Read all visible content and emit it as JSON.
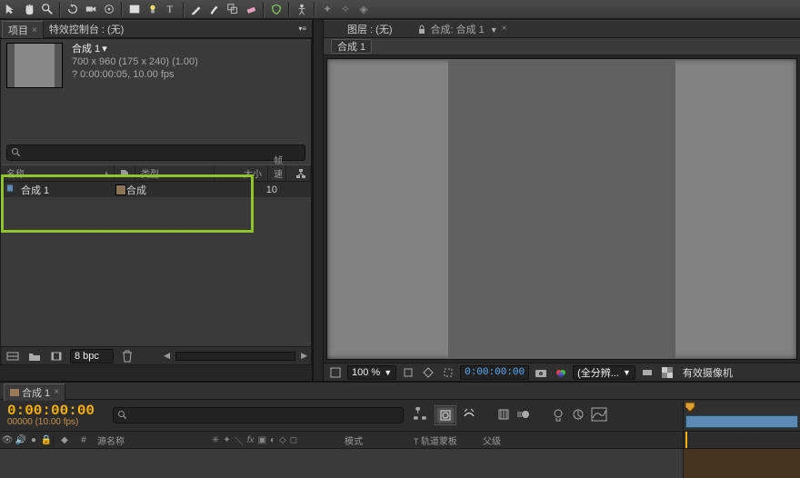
{
  "toolbar_icons": [
    "selection",
    "hand",
    "zoom",
    "rotate",
    "camera-orbit",
    "pan-behind",
    "rect",
    "pen",
    "type",
    "brush",
    "eraser",
    "puppet",
    "roto",
    "graph",
    "transform",
    "grid",
    "axis",
    "3d",
    "sun",
    "star"
  ],
  "panels": {
    "project_tab": "项目",
    "fx_tab": "特效控制台 :  (无)",
    "layer_tab": "图层 :  (无)"
  },
  "comp": {
    "name": "合成 1",
    "meta1": "700 x 960  (175 x 240) (1.00)",
    "meta2": "? 0:00:00:05, 10.00 fps",
    "dd_marker": "▾"
  },
  "project": {
    "headers": {
      "name": "名称",
      "type": "类型",
      "size": "大小",
      "fps": "帧速率"
    },
    "rows": [
      {
        "name": "合成 1",
        "type": "合成",
        "size": "",
        "fps": "10"
      }
    ]
  },
  "project_footer": {
    "bpc": "8 bpc"
  },
  "viewer_tab": "合成: 合成 1",
  "breadcrumb": "合成 1",
  "viewer_footer": {
    "zoom": "100 %",
    "time": "0:00:00:00",
    "res": "(全分辨...",
    "camera": "有效摄像机"
  },
  "timeline": {
    "tab": "合成 1",
    "timecode": "0:00:00:00",
    "timecode_sub": "00000 (10.00 fps)",
    "cols": {
      "source_name": "源名称",
      "mode": "模式",
      "matte": "轨道蒙板",
      "parent": "父级"
    }
  }
}
